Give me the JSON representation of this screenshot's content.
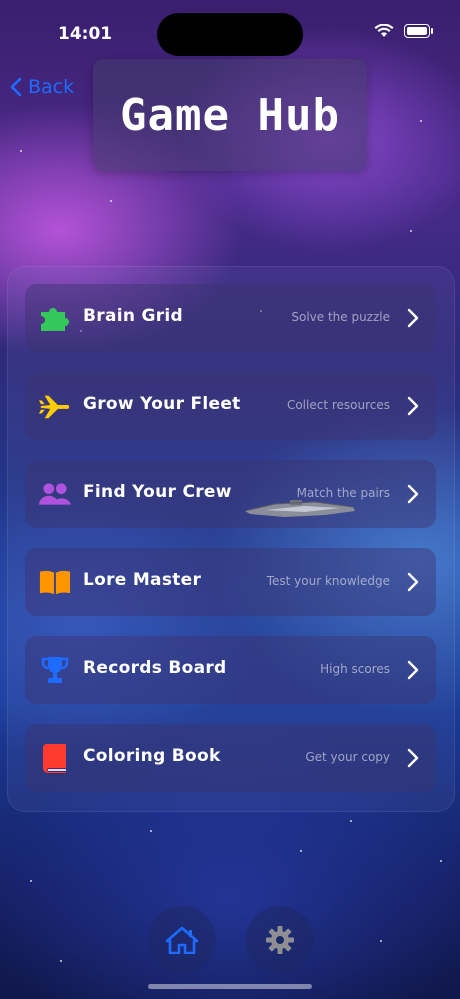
{
  "status_bar": {
    "time": "14:01"
  },
  "nav": {
    "back_label": "Back"
  },
  "title": "Game Hub",
  "menu": {
    "items": [
      {
        "label": "Brain Grid",
        "subtitle": "Solve the puzzle",
        "icon": "puzzle-icon",
        "color": "#34c759"
      },
      {
        "label": "Grow Your Fleet",
        "subtitle": "Collect resources",
        "icon": "airplane-icon",
        "color": "#ffcc00"
      },
      {
        "label": "Find Your Crew",
        "subtitle": "Match the pairs",
        "icon": "people-icon",
        "color": "#af52de"
      },
      {
        "label": "Lore Master",
        "subtitle": "Test your knowledge",
        "icon": "book-open-icon",
        "color": "#ff9500"
      },
      {
        "label": "Records Board",
        "subtitle": "High scores",
        "icon": "trophy-icon",
        "color": "#1e6cff"
      },
      {
        "label": "Coloring Book",
        "subtitle": "Get your copy",
        "icon": "book-closed-icon",
        "color": "#ff3b30"
      }
    ]
  },
  "tab_bar": {
    "home_icon": "house-icon",
    "settings_icon": "gear-icon",
    "active_color": "#1e6cff",
    "inactive_color": "#8e8e93"
  }
}
